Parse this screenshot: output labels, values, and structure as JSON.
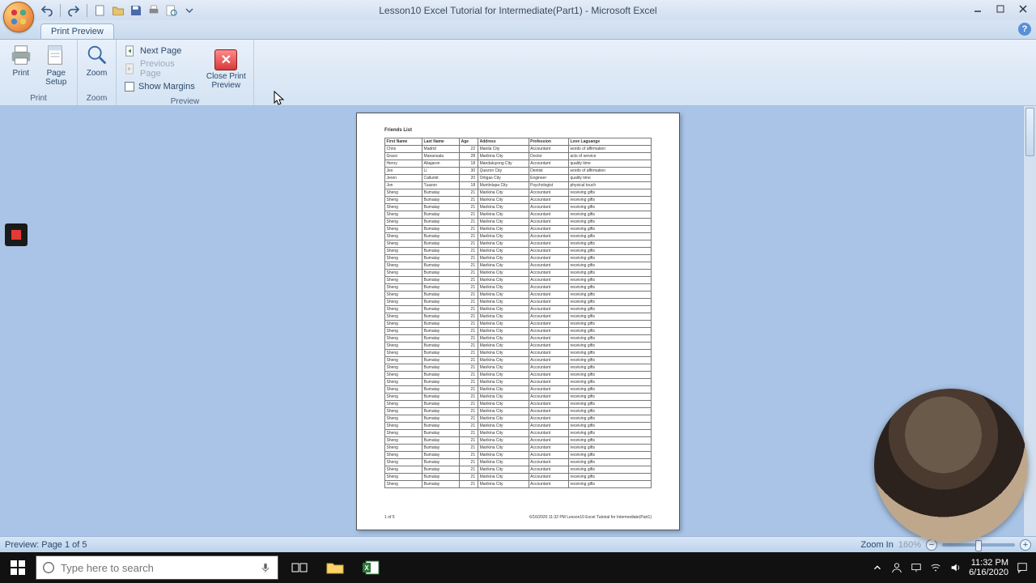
{
  "window": {
    "title": "Lesson10 Excel Tutorial for Intermediate(Part1) - Microsoft Excel"
  },
  "tabs": {
    "active": "Print Preview"
  },
  "ribbon": {
    "print_group": "Print",
    "print_btn": "Print",
    "page_setup_btn": "Page\nSetup",
    "zoom_group": "Zoom",
    "zoom_btn": "Zoom",
    "preview_group": "Preview",
    "next_page": "Next Page",
    "prev_page": "Previous Page",
    "show_margins": "Show Margins",
    "close_preview": "Close Print\nPreview"
  },
  "doc": {
    "title": "Friends List",
    "headers": [
      "First Name",
      "Last Name",
      "Age",
      "Address",
      "Profession",
      "Love Laguange"
    ],
    "rows": [
      [
        "Chris",
        "Madrid",
        "22",
        "Manila City",
        "Accountant",
        "words of affirmation"
      ],
      [
        "Grace",
        "Manansala",
        "28",
        "Marikina City",
        "Doctor",
        "acts of service"
      ],
      [
        "Henry",
        "Abajaron",
        "18",
        "Mandaluyong City",
        "Accountant",
        "quality time"
      ],
      [
        "Jes",
        "Li",
        "30",
        "Quezon City",
        "Dentist",
        "words of affirmation"
      ],
      [
        "Jeren",
        "Callumit",
        "20",
        "Ortigas City",
        "Engineer",
        "quality time"
      ],
      [
        "Jon",
        "Tuazon",
        "18",
        "Muntinlupa City",
        "Psychologist",
        "physical touch"
      ],
      [
        "Sheng",
        "Bumatay",
        "21",
        "Marikina City",
        "Accountant",
        "receiving gifts"
      ],
      [
        "Sheng",
        "Bumatay",
        "21",
        "Marikina City",
        "Accountant",
        "receiving gifts"
      ],
      [
        "Sheng",
        "Bumatay",
        "21",
        "Marikina City",
        "Accountant",
        "receiving gifts"
      ],
      [
        "Sheng",
        "Bumatay",
        "21",
        "Marikina City",
        "Accountant",
        "receiving gifts"
      ],
      [
        "Sheng",
        "Bumatay",
        "21",
        "Marikina City",
        "Accountant",
        "receiving gifts"
      ],
      [
        "Sheng",
        "Bumatay",
        "21",
        "Marikina City",
        "Accountant",
        "receiving gifts"
      ],
      [
        "Sheng",
        "Bumatay",
        "21",
        "Marikina City",
        "Accountant",
        "receiving gifts"
      ],
      [
        "Sheng",
        "Bumatay",
        "21",
        "Marikina City",
        "Accountant",
        "receiving gifts"
      ],
      [
        "Sheng",
        "Bumatay",
        "21",
        "Marikina City",
        "Accountant",
        "receiving gifts"
      ],
      [
        "Sheng",
        "Bumatay",
        "21",
        "Marikina City",
        "Accountant",
        "receiving gifts"
      ],
      [
        "Sheng",
        "Bumatay",
        "21",
        "Marikina City",
        "Accountant",
        "receiving gifts"
      ],
      [
        "Sheng",
        "Bumatay",
        "21",
        "Marikina City",
        "Accountant",
        "receiving gifts"
      ],
      [
        "Sheng",
        "Bumatay",
        "21",
        "Marikina City",
        "Accountant",
        "receiving gifts"
      ],
      [
        "Sheng",
        "Bumatay",
        "21",
        "Marikina City",
        "Accountant",
        "receiving gifts"
      ],
      [
        "Sheng",
        "Bumatay",
        "21",
        "Marikina City",
        "Accountant",
        "receiving gifts"
      ],
      [
        "Sheng",
        "Bumatay",
        "21",
        "Marikina City",
        "Accountant",
        "receiving gifts"
      ],
      [
        "Sheng",
        "Bumatay",
        "21",
        "Marikina City",
        "Accountant",
        "receiving gifts"
      ],
      [
        "Sheng",
        "Bumatay",
        "21",
        "Marikina City",
        "Accountant",
        "receiving gifts"
      ],
      [
        "Sheng",
        "Bumatay",
        "21",
        "Marikina City",
        "Accountant",
        "receiving gifts"
      ],
      [
        "Sheng",
        "Bumatay",
        "21",
        "Marikina City",
        "Accountant",
        "receiving gifts"
      ],
      [
        "Sheng",
        "Bumatay",
        "21",
        "Marikina City",
        "Accountant",
        "receiving gifts"
      ],
      [
        "Sheng",
        "Bumatay",
        "21",
        "Marikina City",
        "Accountant",
        "receiving gifts"
      ],
      [
        "Sheng",
        "Bumatay",
        "21",
        "Marikina City",
        "Accountant",
        "receiving gifts"
      ],
      [
        "Sheng",
        "Bumatay",
        "21",
        "Marikina City",
        "Accountant",
        "receiving gifts"
      ],
      [
        "Sheng",
        "Bumatay",
        "21",
        "Marikina City",
        "Accountant",
        "receiving gifts"
      ],
      [
        "Sheng",
        "Bumatay",
        "21",
        "Marikina City",
        "Accountant",
        "receiving gifts"
      ],
      [
        "Sheng",
        "Bumatay",
        "21",
        "Marikina City",
        "Accountant",
        "receiving gifts"
      ],
      [
        "Sheng",
        "Bumatay",
        "21",
        "Marikina City",
        "Accountant",
        "receiving gifts"
      ],
      [
        "Sheng",
        "Bumatay",
        "21",
        "Marikina City",
        "Accountant",
        "receiving gifts"
      ],
      [
        "Sheng",
        "Bumatay",
        "21",
        "Marikina City",
        "Accountant",
        "receiving gifts"
      ],
      [
        "Sheng",
        "Bumatay",
        "21",
        "Marikina City",
        "Accountant",
        "receiving gifts"
      ],
      [
        "Sheng",
        "Bumatay",
        "21",
        "Marikina City",
        "Accountant",
        "receiving gifts"
      ],
      [
        "Sheng",
        "Bumatay",
        "21",
        "Marikina City",
        "Accountant",
        "receiving gifts"
      ],
      [
        "Sheng",
        "Bumatay",
        "21",
        "Marikina City",
        "Accountant",
        "receiving gifts"
      ],
      [
        "Sheng",
        "Bumatay",
        "21",
        "Marikina City",
        "Accountant",
        "receiving gifts"
      ],
      [
        "Sheng",
        "Bumatay",
        "21",
        "Marikina City",
        "Accountant",
        "receiving gifts"
      ],
      [
        "Sheng",
        "Bumatay",
        "21",
        "Marikina City",
        "Accountant",
        "receiving gifts"
      ],
      [
        "Sheng",
        "Bumatay",
        "21",
        "Marikina City",
        "Accountant",
        "receiving gifts"
      ],
      [
        "Sheng",
        "Bumatay",
        "21",
        "Marikina City",
        "Accountant",
        "receiving gifts"
      ],
      [
        "Sheng",
        "Bumatay",
        "21",
        "Marikina City",
        "Accountant",
        "receiving gifts"
      ],
      [
        "Sheng",
        "Bumatay",
        "21",
        "Marikina City",
        "Accountant",
        "receiving gifts"
      ]
    ],
    "footer_left": "1 of 5",
    "footer_right": "6/16/2020 11:32 PM   Lesson10 Excel Tutorial for Intermediate(Part1)"
  },
  "statusbar": {
    "left": "Preview: Page 1 of 5",
    "zoom_label": "Zoom In",
    "zoom_pct": "160%"
  },
  "taskbar": {
    "search_placeholder": "Type here to search",
    "time": "11:32 PM",
    "date": "6/16/2020"
  }
}
